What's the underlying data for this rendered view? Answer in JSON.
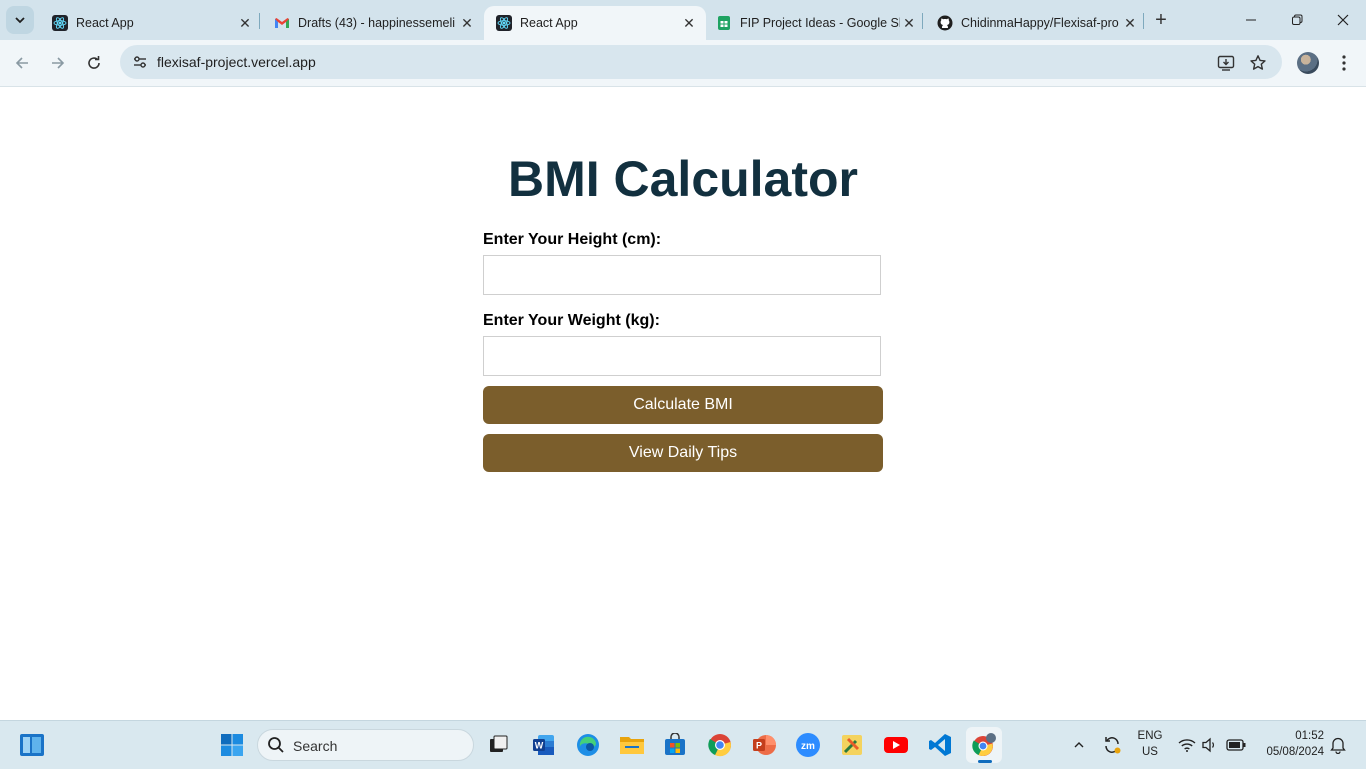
{
  "browser": {
    "tabs": [
      {
        "title": "React App",
        "favicon": "react-icon",
        "active": false
      },
      {
        "title": "Drafts (43) - happinessemeli",
        "favicon": "gmail-icon",
        "active": false
      },
      {
        "title": "React App",
        "favicon": "react-icon",
        "active": true
      },
      {
        "title": "FIP Project Ideas - Google Sl",
        "favicon": "google-sheets-icon",
        "active": false
      },
      {
        "title": "ChidinmaHappy/Flexisaf-pro",
        "favicon": "github-icon",
        "active": false
      }
    ],
    "address_bar": {
      "url": "flexisaf-project.vercel.app"
    }
  },
  "page": {
    "title": "BMI Calculator",
    "height_label": "Enter Your Height (cm):",
    "height_value": "",
    "weight_label": "Enter Your Weight (kg):",
    "weight_value": "",
    "calculate_button": "Calculate BMI",
    "tips_button": "View Daily Tips",
    "button_color": "#7b5e2c",
    "title_color": "#12303f"
  },
  "taskbar": {
    "search_placeholder": "Search",
    "language": "ENG",
    "region": "US",
    "time": "01:52",
    "date": "05/08/2024",
    "apps": [
      "start-icon",
      "task-view-icon",
      "word-icon",
      "edge-icon",
      "file-explorer-icon",
      "store-icon",
      "chrome-icon",
      "powerpoint-icon",
      "zoom-icon",
      "tools-icon",
      "youtube-icon",
      "vscode-icon",
      "chrome-profile-icon"
    ]
  }
}
